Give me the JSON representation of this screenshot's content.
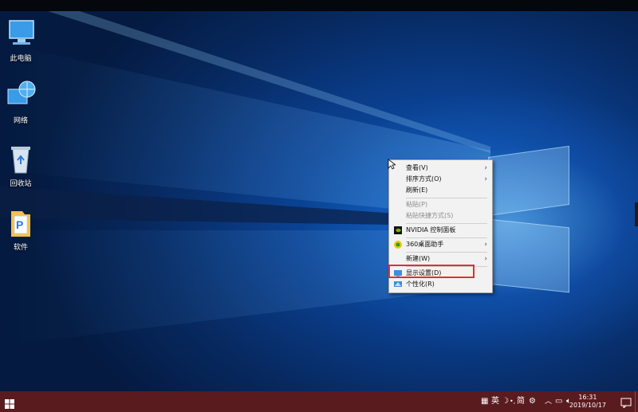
{
  "desktop_icons": [
    {
      "label": "此电脑",
      "icon": "computer-icon"
    },
    {
      "label": "网络",
      "icon": "network-icon"
    },
    {
      "label": "回收站",
      "icon": "recycle-bin-icon"
    },
    {
      "label": "软件",
      "icon": "folder-icon"
    }
  ],
  "context_menu": {
    "items": [
      {
        "label": "查看(V)",
        "submenu": true,
        "enabled": true
      },
      {
        "label": "排序方式(O)",
        "submenu": true,
        "enabled": true
      },
      {
        "label": "刷新(E)",
        "submenu": false,
        "enabled": true
      },
      {
        "label": "粘贴(P)",
        "submenu": false,
        "enabled": false
      },
      {
        "label": "粘贴快捷方式(S)",
        "submenu": false,
        "enabled": false
      },
      {
        "label": "NVIDIA 控制面板",
        "submenu": false,
        "enabled": true,
        "icon": "nvidia-icon"
      },
      {
        "label": "360桌面助手",
        "submenu": true,
        "enabled": true,
        "icon": "360-icon"
      },
      {
        "label": "新建(W)",
        "submenu": true,
        "enabled": true
      },
      {
        "label": "显示设置(D)",
        "submenu": false,
        "enabled": true,
        "icon": "display-settings-icon",
        "highlighted": true
      },
      {
        "label": "个性化(R)",
        "submenu": false,
        "enabled": true,
        "icon": "personalize-icon"
      }
    ]
  },
  "taskbar": {
    "tray_text": "英",
    "tray_text2": "简",
    "time": "16:31",
    "date": "2019/10/17"
  },
  "colors": {
    "taskbar": "#5a1b1f",
    "highlight_box": "#e03030",
    "desktop_blue": "#0a3f8e"
  }
}
